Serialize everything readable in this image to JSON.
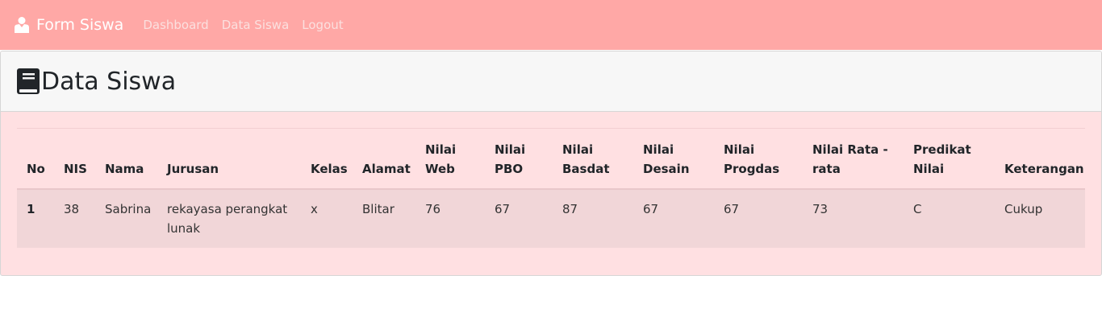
{
  "navbar": {
    "brand": "Form Siswa",
    "brand_icon": "user-graduate-icon",
    "links": [
      "Dashboard",
      "Data Siswa",
      "Logout"
    ]
  },
  "header": {
    "title": "Data Siswa",
    "icon": "book-icon"
  },
  "table": {
    "columns": [
      "No",
      "NIS",
      "Nama",
      "Jurusan",
      "Kelas",
      "Alamat",
      "Nilai Web",
      "Nilai PBO",
      "Nilai Basdat",
      "Nilai Desain",
      "Nilai Progdas",
      "Nilai Rata - rata",
      "Predikat Nilai",
      "Keterangan"
    ],
    "rows": [
      [
        "1",
        "38",
        "Sabrina",
        "rekayasa perangkat lunak",
        "x",
        "Blitar",
        "76",
        "67",
        "87",
        "67",
        "67",
        "73",
        "C",
        "Cukup"
      ]
    ]
  },
  "colors": {
    "navbar": "#ffa8a6",
    "card_body": "#ffe0e2",
    "row": "#f1d6d8"
  }
}
